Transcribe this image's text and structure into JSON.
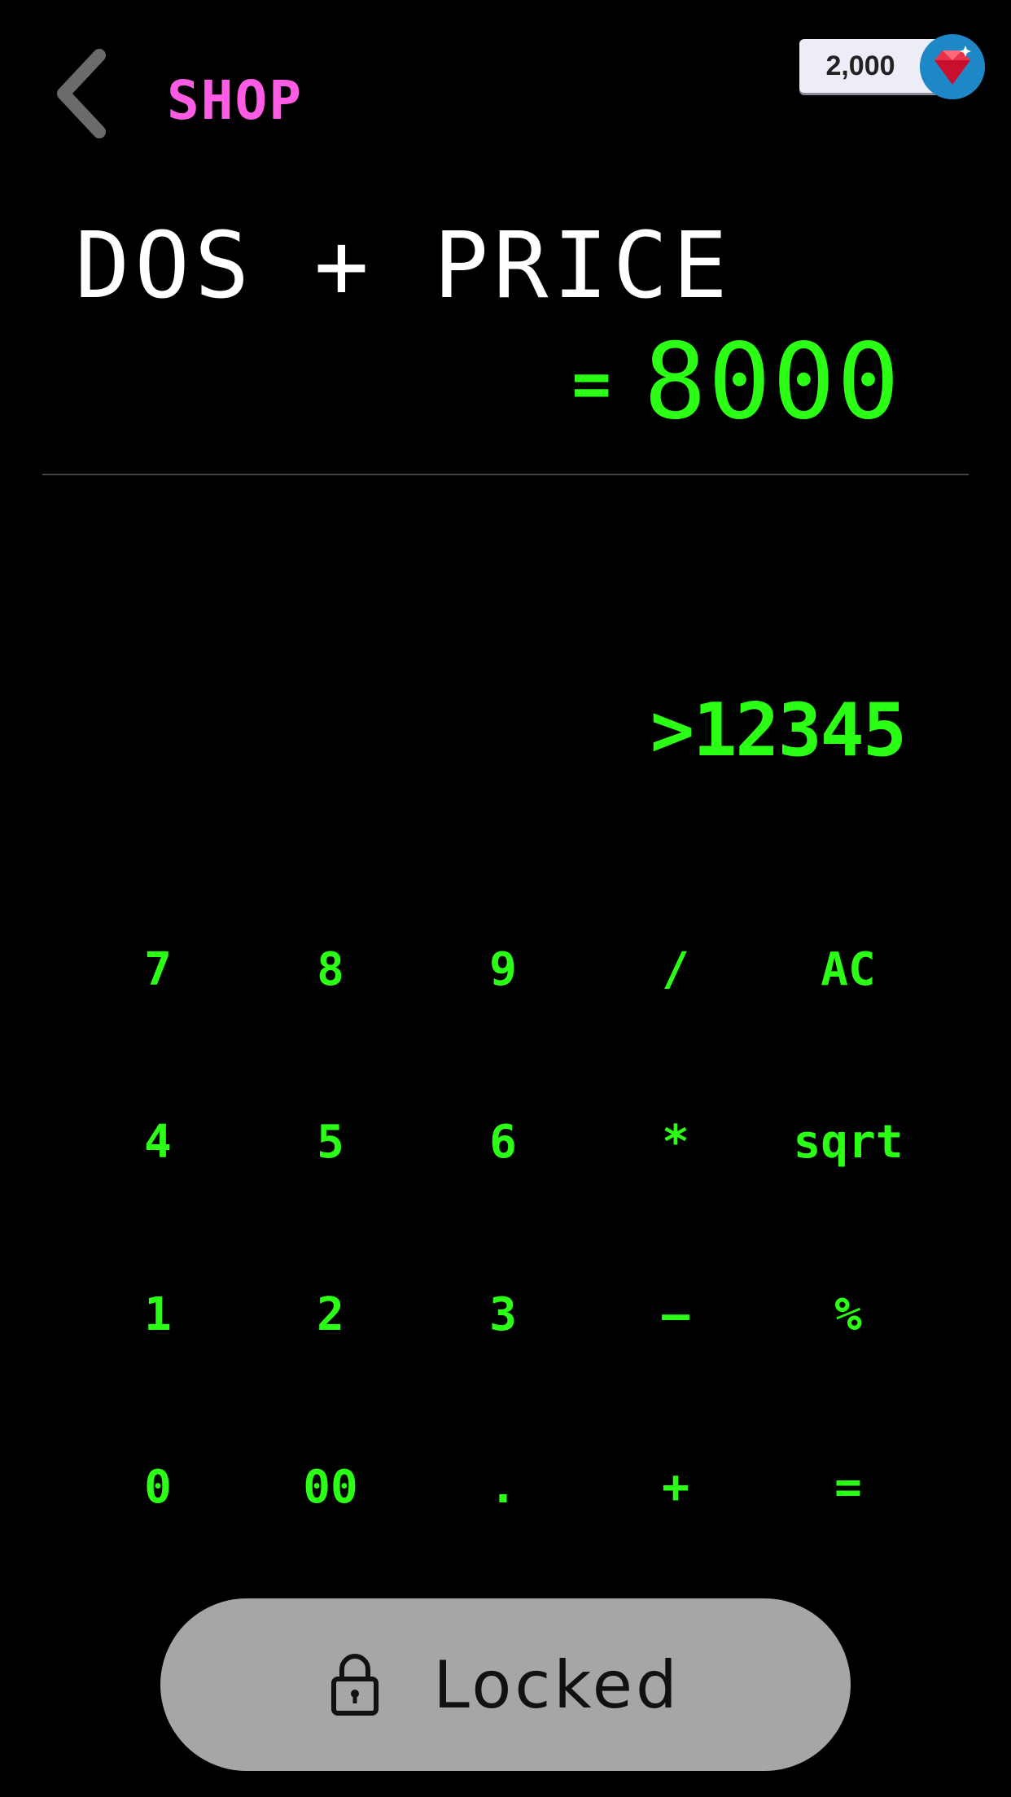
{
  "header": {
    "back_icon": "chevron-left-icon",
    "title": "SHOP",
    "gem_count": "2,000",
    "gem_icon": "diamond-gem-icon"
  },
  "product": {
    "name": "DOS + PRICE",
    "price_prefix": "=",
    "price": "8000"
  },
  "calculator": {
    "display": ">12345",
    "keys": [
      [
        "7",
        "8",
        "9",
        "/",
        "AC"
      ],
      [
        "4",
        "5",
        "6",
        "*",
        "sqrt"
      ],
      [
        "1",
        "2",
        "3",
        "—",
        "%"
      ],
      [
        "0",
        "00",
        ".",
        "+",
        "="
      ]
    ]
  },
  "footer": {
    "button_label": "Locked",
    "button_icon": "padlock-icon"
  },
  "colors": {
    "background": "#000000",
    "terminal_green": "#2bff16",
    "shop_pink": "#ff5ce6",
    "heading_white": "#ffffff",
    "back_gray": "#6b6b6b",
    "locked_gray": "#a6a6a6"
  }
}
